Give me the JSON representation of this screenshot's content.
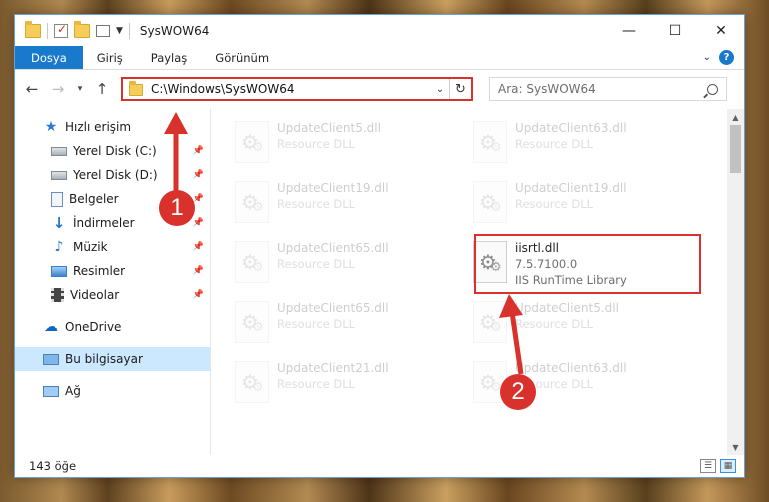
{
  "window": {
    "title": "SysWOW64"
  },
  "ribbon": {
    "tabs": [
      "Dosya",
      "Giriş",
      "Paylaş",
      "Görünüm"
    ],
    "help_label": "?"
  },
  "nav": {
    "address": "C:\\Windows\\SysWOW64",
    "search_placeholder": "Ara: SysWOW64"
  },
  "sidebar": {
    "items": [
      {
        "label": "Hızlı erişim",
        "icon": "star-icon",
        "level": 0,
        "pinned": false
      },
      {
        "label": "Yerel Disk (C:)",
        "icon": "drive-icon",
        "level": 1,
        "pinned": true
      },
      {
        "label": "Yerel Disk (D:)",
        "icon": "drive-icon",
        "level": 1,
        "pinned": true
      },
      {
        "label": "Belgeler",
        "icon": "documents-icon",
        "level": 1,
        "pinned": true
      },
      {
        "label": "İndirmeler",
        "icon": "downloads-icon",
        "level": 1,
        "pinned": true
      },
      {
        "label": "Müzik",
        "icon": "music-icon",
        "level": 1,
        "pinned": true
      },
      {
        "label": "Resimler",
        "icon": "pictures-icon",
        "level": 1,
        "pinned": true
      },
      {
        "label": "Videolar",
        "icon": "videos-icon",
        "level": 1,
        "pinned": true
      },
      {
        "label": "OneDrive",
        "icon": "onedrive-icon",
        "level": 0,
        "pinned": false
      },
      {
        "label": "Bu bilgisayar",
        "icon": "this-pc-icon",
        "level": 0,
        "pinned": false,
        "selected": true
      },
      {
        "label": "Ağ",
        "icon": "network-icon",
        "level": 0,
        "pinned": false
      }
    ]
  },
  "files": [
    {
      "name": "UpdateClient5.dll",
      "desc": "Resource DLL",
      "faded": true
    },
    {
      "name": "UpdateClient63.dll",
      "desc": "Resource DLL",
      "faded": true
    },
    {
      "name": "UpdateClient19.dll",
      "desc": "Resource DLL",
      "faded": true
    },
    {
      "name": "UpdateClient19.dll",
      "desc": "Resource DLL",
      "faded": true
    },
    {
      "name": "UpdateClient65.dll",
      "desc": "Resource DLL",
      "faded": true
    },
    {
      "name": "iisrtl.dll",
      "version": "7.5.7100.0",
      "desc": "IIS RunTime Library",
      "faded": false
    },
    {
      "name": "UpdateClient65.dll",
      "desc": "Resource DLL",
      "faded": true
    },
    {
      "name": "UpdateClient5.dll",
      "desc": "Resource DLL",
      "faded": true
    },
    {
      "name": "UpdateClient21.dll",
      "desc": "Resource DLL",
      "faded": true
    },
    {
      "name": "UpdateClient63.dll",
      "desc": "Resource DLL",
      "faded": true
    }
  ],
  "status": {
    "count": "143 öğe"
  },
  "annotations": {
    "badge1": "1",
    "badge2": "2",
    "color": "#d9312b"
  }
}
